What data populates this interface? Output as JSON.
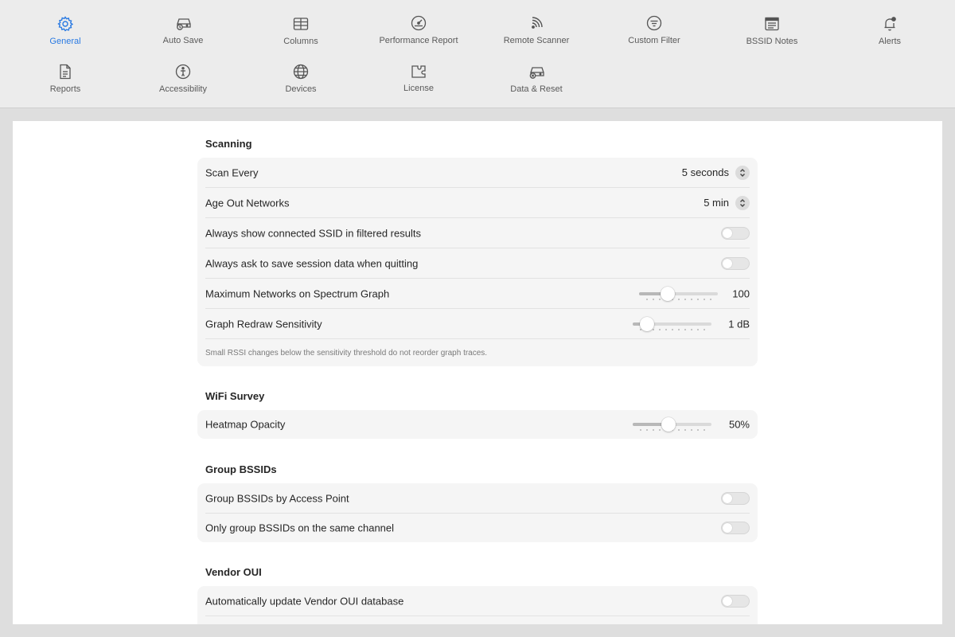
{
  "toolbar": {
    "items": [
      {
        "label": "General",
        "icon": "gear-icon",
        "active": true
      },
      {
        "label": "Auto Save",
        "icon": "drive-clock-icon"
      },
      {
        "label": "Columns",
        "icon": "table-icon"
      },
      {
        "label": "Performance Report",
        "icon": "gauge-icon"
      },
      {
        "label": "Remote Scanner",
        "icon": "rss-icon"
      },
      {
        "label": "Custom Filter",
        "icon": "filter-icon"
      },
      {
        "label": "BSSID Notes",
        "icon": "notes-icon"
      },
      {
        "label": "Alerts",
        "icon": "bell-icon"
      },
      {
        "label": "Reports",
        "icon": "document-icon"
      },
      {
        "label": "Accessibility",
        "icon": "accessibility-icon"
      },
      {
        "label": "Devices",
        "icon": "globe-icon"
      },
      {
        "label": "License",
        "icon": "puzzle-icon"
      },
      {
        "label": "Data & Reset",
        "icon": "drive-x-icon"
      }
    ],
    "accent_color": "#2a7ae2"
  },
  "sections": {
    "scanning": {
      "title": "Scanning",
      "scan_every": {
        "label": "Scan Every",
        "value": "5 seconds"
      },
      "age_out": {
        "label": "Age Out Networks",
        "value": "5 min"
      },
      "always_show_ssid": {
        "label": "Always show connected SSID in filtered results",
        "on": false
      },
      "ask_save": {
        "label": "Always ask to save session data when quitting",
        "on": false
      },
      "max_networks": {
        "label": "Maximum Networks on Spectrum Graph",
        "value": "100",
        "level": 0.36
      },
      "redraw": {
        "label": "Graph Redraw Sensitivity",
        "value": "1 dB",
        "level": 0.18
      },
      "note": "Small RSSI changes below the sensitivity threshold do not reorder graph traces."
    },
    "wifi_survey": {
      "title": "WiFi Survey",
      "heatmap": {
        "label": "Heatmap Opacity",
        "value": "50%",
        "level": 0.45
      }
    },
    "group_bssids": {
      "title": "Group BSSIDs",
      "by_ap": {
        "label": "Group BSSIDs by Access Point",
        "on": false
      },
      "same_channel": {
        "label": "Only group BSSIDs on the same channel",
        "on": false
      }
    },
    "vendor_oui": {
      "title": "Vendor OUI",
      "auto_update": {
        "label": "Automatically update Vendor OUI database",
        "on": false
      }
    }
  }
}
